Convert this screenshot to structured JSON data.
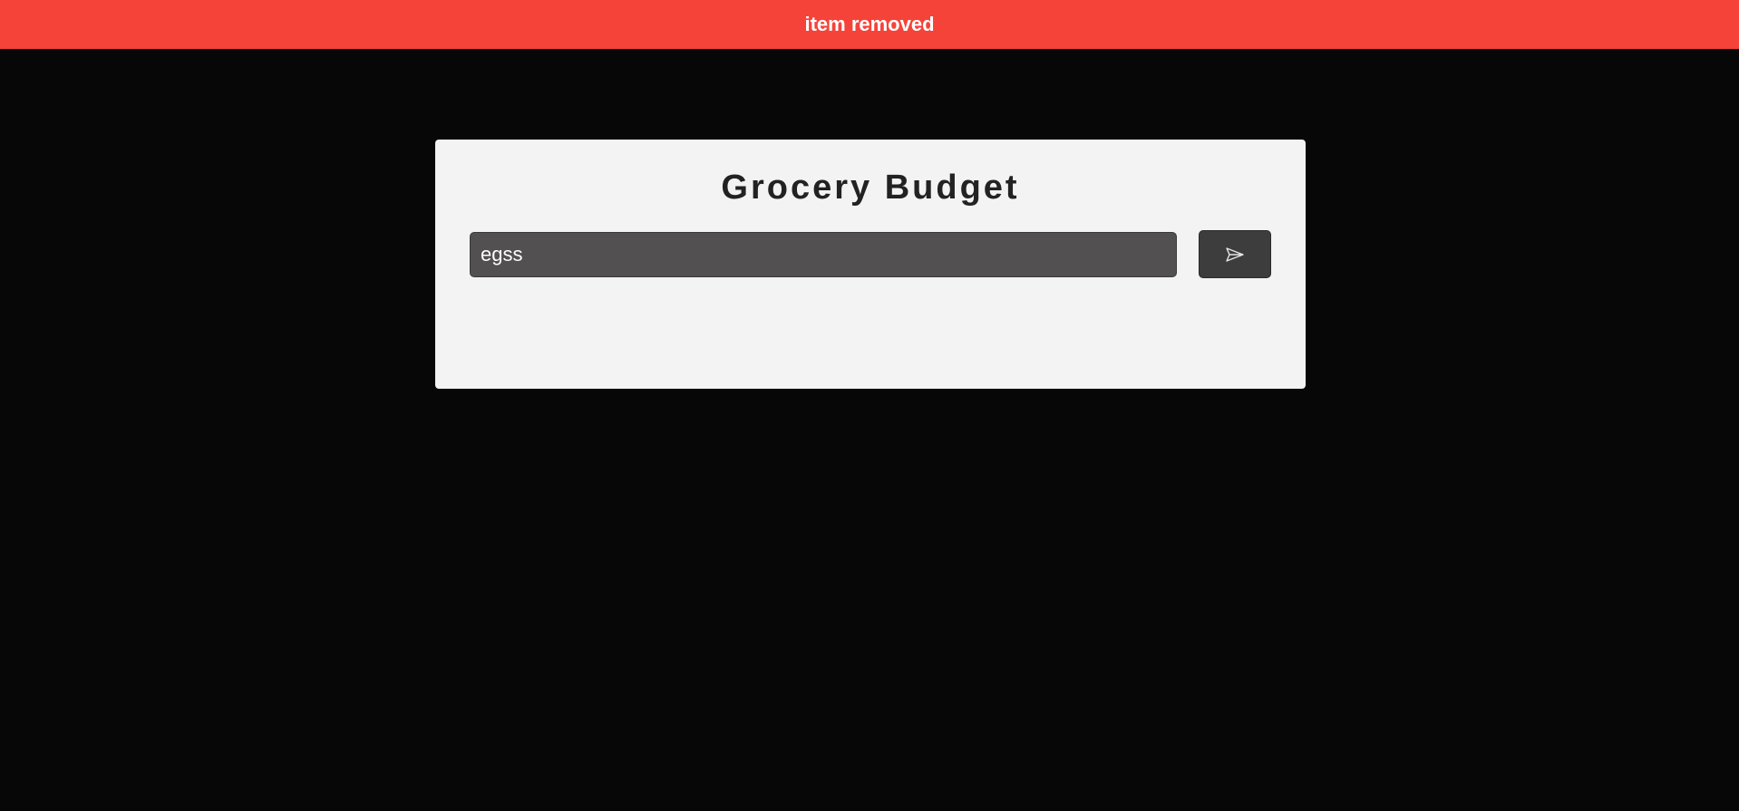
{
  "notification": {
    "message": "item removed",
    "color": "#f5433a"
  },
  "app": {
    "title": "Grocery Budget"
  },
  "form": {
    "input_value": "egss",
    "submit_icon": "send-icon"
  },
  "colors": {
    "background": "#070707",
    "card": "#f3f3f3",
    "input": "#525051",
    "button": "#3d3d3d"
  }
}
